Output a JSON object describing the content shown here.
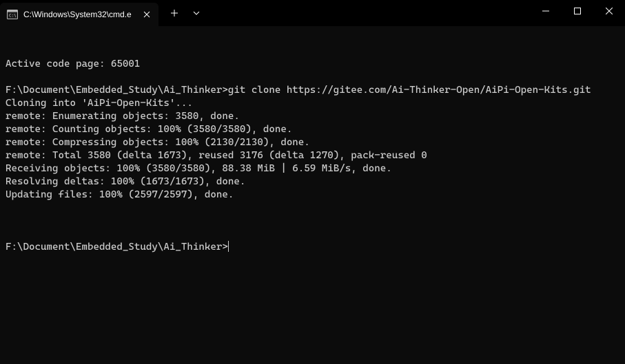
{
  "tab": {
    "title": "C:\\Windows\\System32\\cmd.e"
  },
  "terminal": {
    "lines": [
      "Active code page: 65001",
      "",
      "F:\\Document\\Embedded_Study\\Ai_Thinker>git clone https://gitee.com/Ai-Thinker-Open/AiPi-Open-Kits.git",
      "Cloning into 'AiPi-Open-Kits'...",
      "remote: Enumerating objects: 3580, done.",
      "remote: Counting objects: 100% (3580/3580), done.",
      "remote: Compressing objects: 100% (2130/2130), done.",
      "remote: Total 3580 (delta 1673), reused 3176 (delta 1270), pack-reused 0",
      "Receiving objects: 100% (3580/3580), 88.38 MiB | 6.59 MiB/s, done.",
      "Resolving deltas: 100% (1673/1673), done.",
      "Updating files: 100% (2597/2597), done.",
      ""
    ],
    "prompt": "F:\\Document\\Embedded_Study\\Ai_Thinker>"
  }
}
